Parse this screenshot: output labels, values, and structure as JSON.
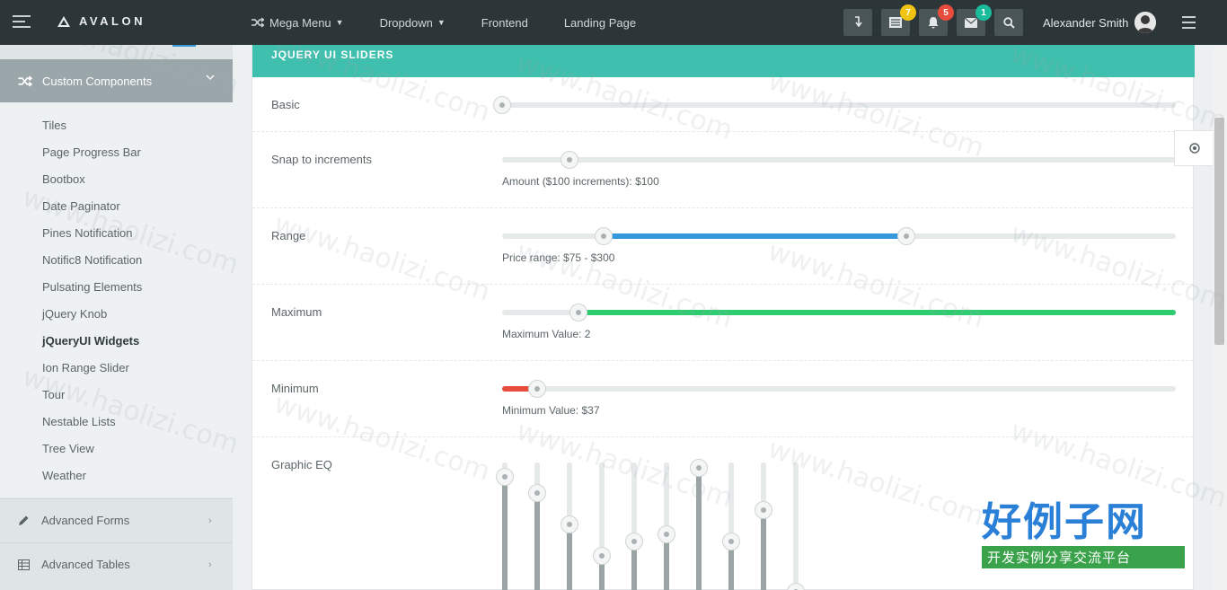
{
  "navbar": {
    "brand": "AVALON",
    "menu": [
      {
        "label": "Mega Menu",
        "has_caret": true
      },
      {
        "label": "Dropdown",
        "has_caret": true
      },
      {
        "label": "Frontend",
        "has_caret": false
      },
      {
        "label": "Landing Page",
        "has_caret": false
      }
    ],
    "badges": {
      "tasks": "7",
      "notifications": "5",
      "messages": "1"
    },
    "badge_colors": {
      "tasks": "#f1c40f",
      "notifications": "#e74c3c",
      "messages": "#1abc9c"
    },
    "user_name": "Alexander Smith"
  },
  "sidebar": {
    "active_section": "Custom Components",
    "submenu": [
      "Tiles",
      "Page Progress Bar",
      "Bootbox",
      "Date Paginator",
      "Pines Notification",
      "Notific8 Notification",
      "Pulsating Elements",
      "jQuery Knob",
      "jQueryUI Widgets",
      "Ion Range Slider",
      "Tour",
      "Nestable Lists",
      "Tree View",
      "Weather"
    ],
    "active_item": "jQueryUI Widgets",
    "sections": [
      "Advanced Forms",
      "Advanced Tables"
    ]
  },
  "panel": {
    "title": "JQUERY UI SLIDERS",
    "rows": {
      "basic": {
        "label": "Basic",
        "value": 0
      },
      "snap": {
        "label": "Snap to increments",
        "caption": "Amount ($100 increments): $100",
        "value": 0.1
      },
      "range": {
        "label": "Range",
        "caption": "Price range: $75 - $300",
        "low": 0.15,
        "high": 0.6,
        "color": "#3498db"
      },
      "maximum": {
        "label": "Maximum",
        "caption": "Maximum Value: 2",
        "value": 0.113,
        "color": "#2ecc71"
      },
      "minimum": {
        "label": "Minimum",
        "caption": "Minimum Value: $37",
        "value": 0.052,
        "color": "#e74c3c"
      },
      "eq": {
        "label": "Graphic EQ",
        "levels": [
          0.9,
          0.79,
          0.57,
          0.35,
          0.45,
          0.5,
          0.96,
          0.45,
          0.67,
          0.1
        ]
      }
    }
  },
  "watermark": {
    "text": "www.haolizi.com",
    "brand_big": "好例子网",
    "brand_small": "开发实例分享交流平台"
  }
}
